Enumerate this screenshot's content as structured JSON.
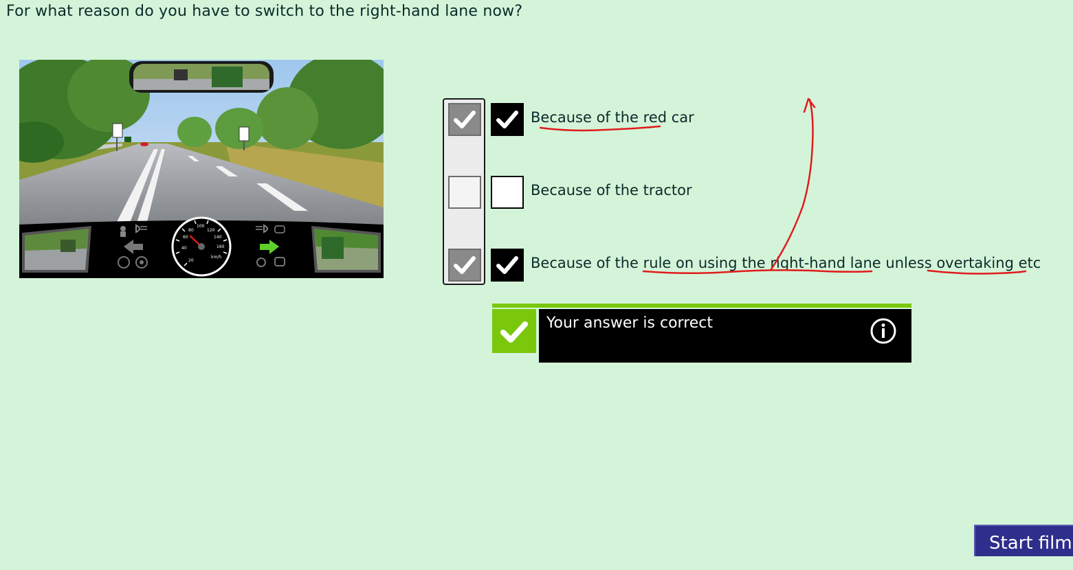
{
  "question": "For what reason do you have to switch to the right-hand lane now?",
  "scene": {
    "speedometer_ticks": [
      "20",
      "40",
      "60",
      "80",
      "100",
      "120",
      "140",
      "160"
    ],
    "speedometer_unit": "km/h",
    "icons": [
      "airbag-icon",
      "headlight-icon",
      "left-arrow-icon",
      "abs-icon",
      "steering-icon",
      "high-beam-icon",
      "traction-icon",
      "right-arrow-icon",
      "fog-light-icon",
      "esp-icon"
    ]
  },
  "answers": [
    {
      "label": "Because of the red car",
      "user_checked": true,
      "solution_checked": true
    },
    {
      "label": "Because of the tractor",
      "user_checked": false,
      "solution_checked": false
    },
    {
      "label": "Because of the rule on using the right-hand lane unless overtaking etc",
      "user_checked": true,
      "solution_checked": true
    }
  ],
  "result": {
    "message": "Your answer is correct",
    "info_icon": "info-icon",
    "status_icon": "checkmark-icon"
  },
  "start_film_label": "Start film",
  "colors": {
    "background": "#d4f4d9",
    "correct_green": "#7ac70c",
    "button_blue": "#2e2e8c",
    "annotation_red": "#e01b1b"
  }
}
